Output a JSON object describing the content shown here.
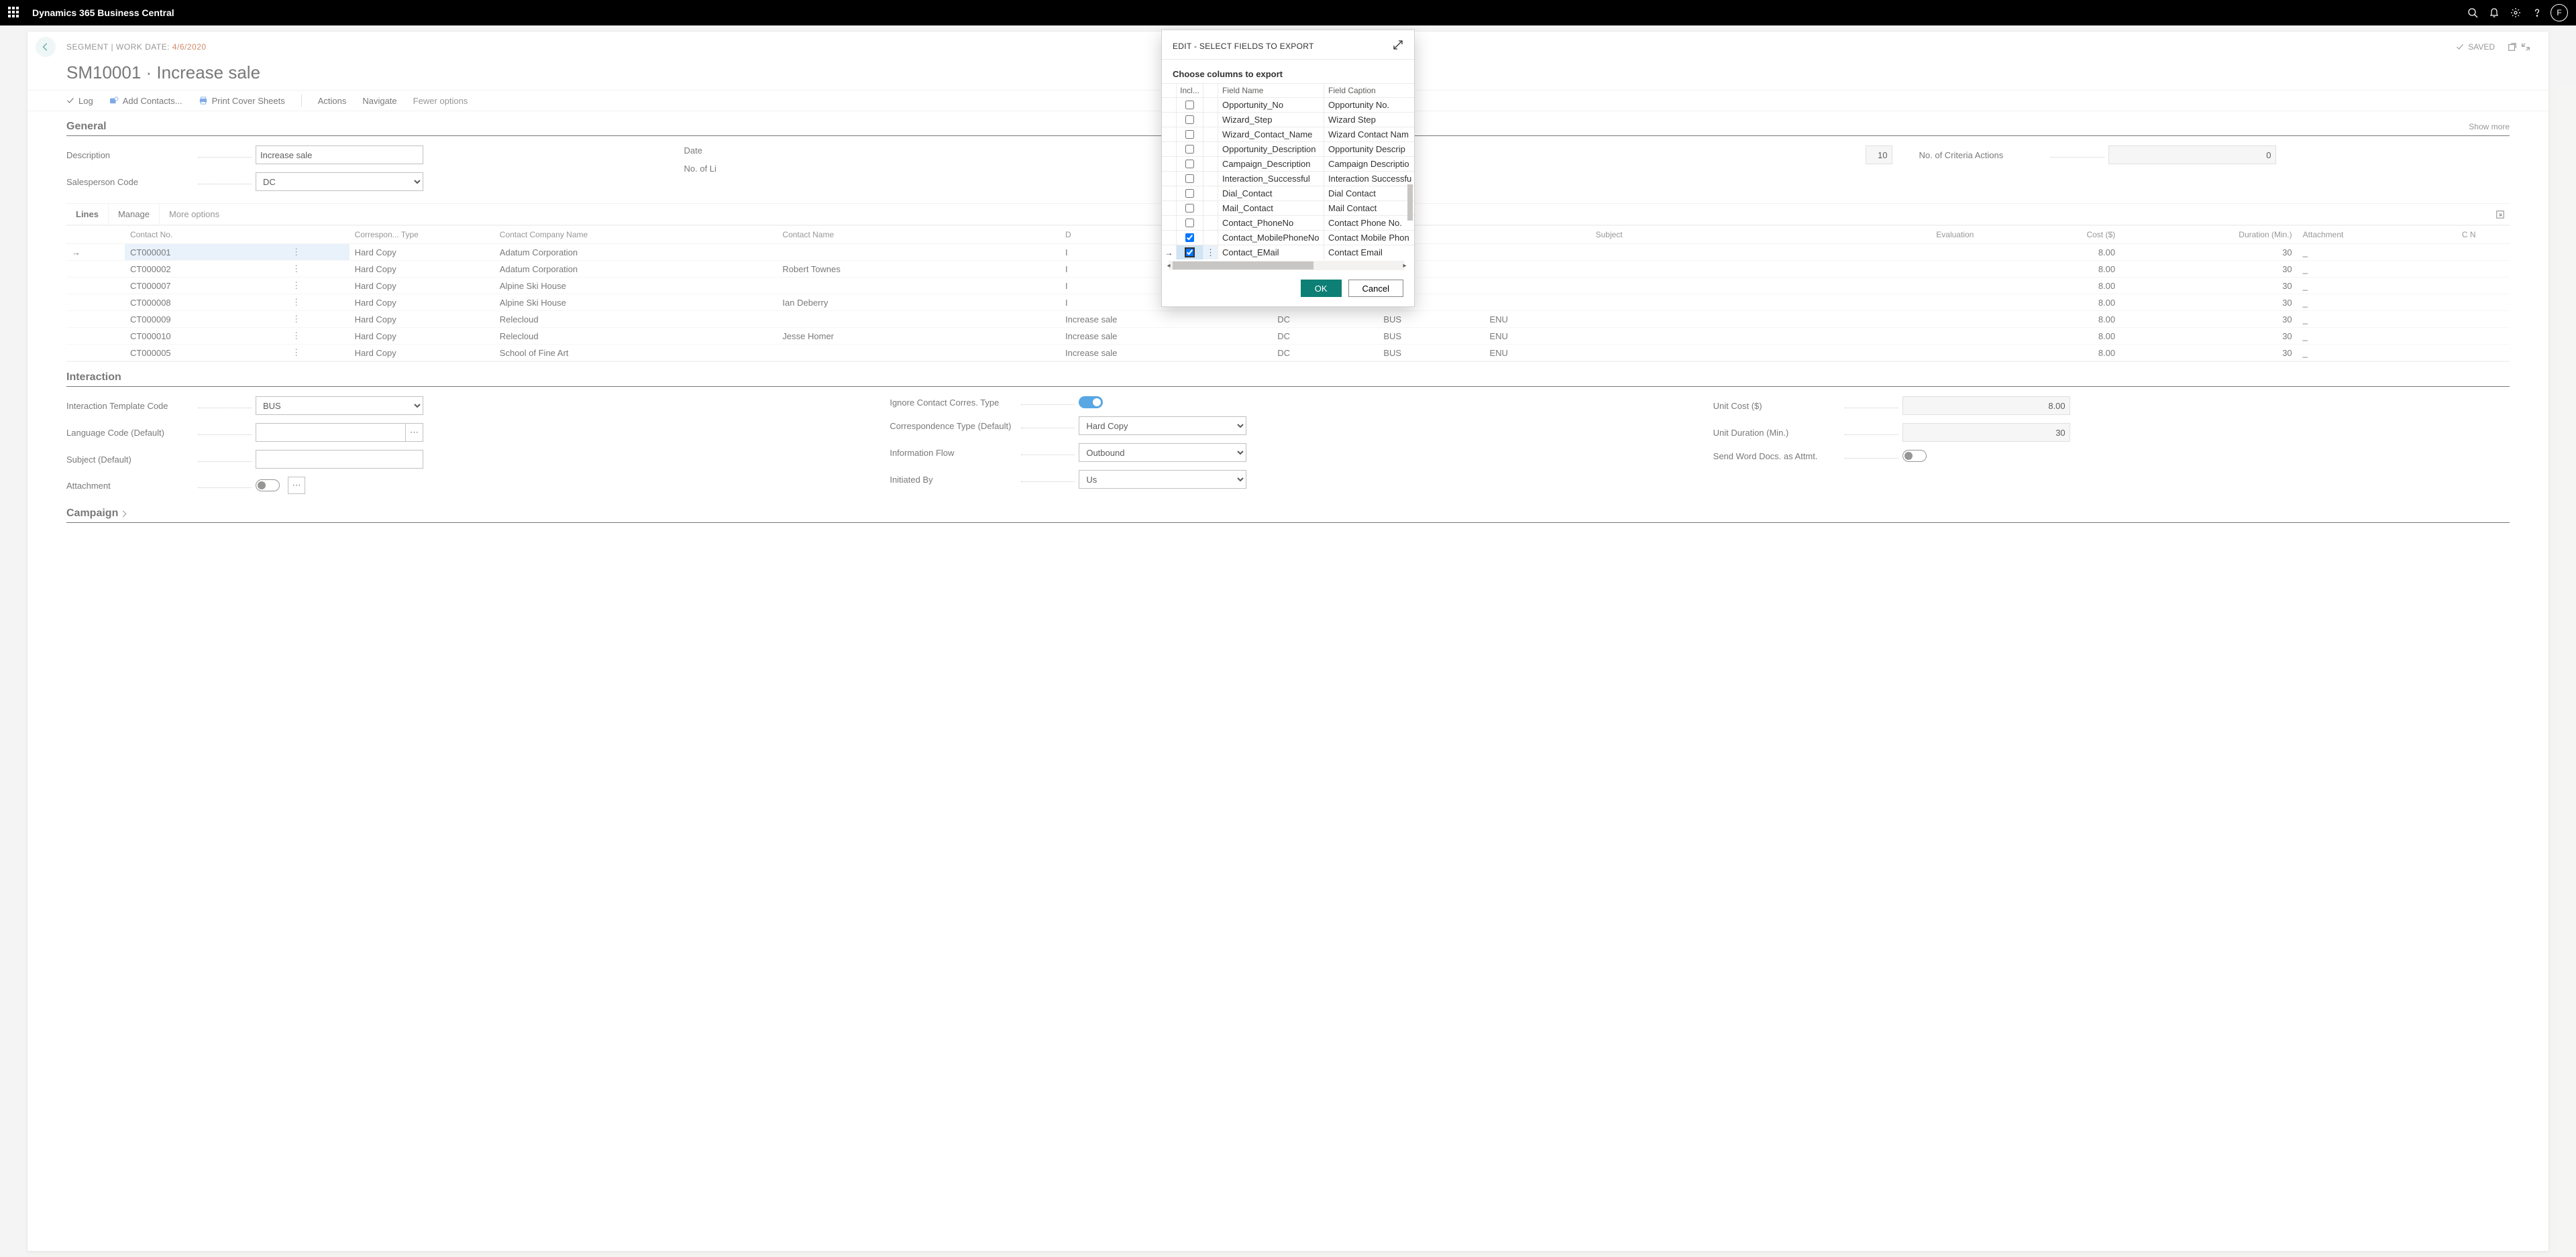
{
  "app": {
    "name": "Dynamics 365 Business Central",
    "avatar": "F"
  },
  "page": {
    "breadcrumb_entity": "SEGMENT",
    "breadcrumb_sep": " | ",
    "breadcrumb_workdate_label": "WORK DATE: ",
    "breadcrumb_workdate": "4/6/2020",
    "title": "SM10001 · Increase sale",
    "saved": "SAVED"
  },
  "actions": {
    "log": "Log",
    "add_contacts": "Add Contacts...",
    "print": "Print Cover Sheets",
    "actions": "Actions",
    "navigate": "Navigate",
    "fewer": "Fewer options"
  },
  "general": {
    "heading": "General",
    "show_more": "Show more",
    "description_label": "Description",
    "description_value": "Increase sale",
    "salesperson_label": "Salesperson Code",
    "salesperson_value": "DC",
    "date_label": "Date",
    "lines_label": "No. of Li",
    "lines_value": "10",
    "criteria_label": "No. of Criteria Actions",
    "criteria_value": "0"
  },
  "lines": {
    "tab1": "Lines",
    "tab2": "Manage",
    "tab3": "More options",
    "columns": {
      "contact_no": "Contact No.",
      "correspon": "Correspon...\nType",
      "company": "Contact Company Name",
      "contact_name": "Contact Name",
      "description": "D",
      "subject": "Subject",
      "evaluation": "Evaluation",
      "cost": "Cost ($)",
      "duration": "Duration (Min.)",
      "attachment": "Attachment",
      "last2": "C\nN"
    },
    "rows": [
      {
        "no": "CT000001",
        "ct": "Hard Copy",
        "company": "Adatum Corporation",
        "name": "",
        "desc": "I",
        "cost": "8.00",
        "dur": "30",
        "att": "_"
      },
      {
        "no": "CT000002",
        "ct": "Hard Copy",
        "company": "Adatum Corporation",
        "name": "Robert Townes",
        "desc": "I",
        "cost": "8.00",
        "dur": "30",
        "att": "_"
      },
      {
        "no": "CT000007",
        "ct": "Hard Copy",
        "company": "Alpine Ski House",
        "name": "",
        "desc": "I",
        "cost": "8.00",
        "dur": "30",
        "att": "_"
      },
      {
        "no": "CT000008",
        "ct": "Hard Copy",
        "company": "Alpine Ski House",
        "name": "Ian Deberry",
        "desc": "I",
        "cost": "8.00",
        "dur": "30",
        "att": "_"
      },
      {
        "no": "CT000009",
        "ct": "Hard Copy",
        "company": "Relecloud",
        "name": "",
        "desc": "Increase sale",
        "sc": "DC",
        "itc": "BUS",
        "lang": "ENU",
        "cost": "8.00",
        "dur": "30",
        "att": "_"
      },
      {
        "no": "CT000010",
        "ct": "Hard Copy",
        "company": "Relecloud",
        "name": "Jesse Homer",
        "desc": "Increase sale",
        "sc": "DC",
        "itc": "BUS",
        "lang": "ENU",
        "cost": "8.00",
        "dur": "30",
        "att": "_"
      },
      {
        "no": "CT000005",
        "ct": "Hard Copy",
        "company": "School of Fine Art",
        "name": "",
        "desc": "Increase sale",
        "sc": "DC",
        "itc": "BUS",
        "lang": "ENU",
        "cost": "8.00",
        "dur": "30",
        "att": "_"
      }
    ]
  },
  "interaction": {
    "heading": "Interaction",
    "template_label": "Interaction Template Code",
    "template_value": "BUS",
    "lang_label": "Language Code (Default)",
    "subject_label": "Subject (Default)",
    "attachment_label": "Attachment",
    "ignore_label": "Ignore Contact Corres. Type",
    "corr_label": "Correspondence Type (Default)",
    "corr_value": "Hard Copy",
    "info_label": "Information Flow",
    "info_value": "Outbound",
    "init_label": "Initiated By",
    "init_value": "Us",
    "cost_label": "Unit Cost ($)",
    "cost_value": "8.00",
    "dur_label": "Unit Duration (Min.)",
    "dur_value": "30",
    "sendword_label": "Send Word Docs. as Attmt."
  },
  "campaign": {
    "heading": "Campaign"
  },
  "modal": {
    "title": "EDIT - SELECT FIELDS TO EXPORT",
    "sub": "Choose columns to export",
    "head_incl": "Incl...",
    "head_name": "Field Name",
    "head_cap": "Field Caption",
    "ok": "OK",
    "cancel": "Cancel",
    "rows": [
      {
        "chk": false,
        "name": "Opportunity_No",
        "cap": "Opportunity No."
      },
      {
        "chk": false,
        "name": "Wizard_Step",
        "cap": "Wizard Step"
      },
      {
        "chk": false,
        "name": "Wizard_Contact_Name",
        "cap": "Wizard Contact Nam"
      },
      {
        "chk": false,
        "name": "Opportunity_Description",
        "cap": "Opportunity Descrip"
      },
      {
        "chk": false,
        "name": "Campaign_Description",
        "cap": "Campaign Descriptio"
      },
      {
        "chk": false,
        "name": "Interaction_Successful",
        "cap": "Interaction Successfu"
      },
      {
        "chk": false,
        "name": "Dial_Contact",
        "cap": "Dial Contact"
      },
      {
        "chk": false,
        "name": "Mail_Contact",
        "cap": "Mail Contact"
      },
      {
        "chk": false,
        "name": "Contact_PhoneNo",
        "cap": "Contact Phone No."
      },
      {
        "chk": true,
        "name": "Contact_MobilePhoneNo",
        "cap": "Contact Mobile Phon"
      },
      {
        "chk": true,
        "name": "Contact_EMail",
        "cap": "Contact Email",
        "selected": true
      }
    ]
  }
}
